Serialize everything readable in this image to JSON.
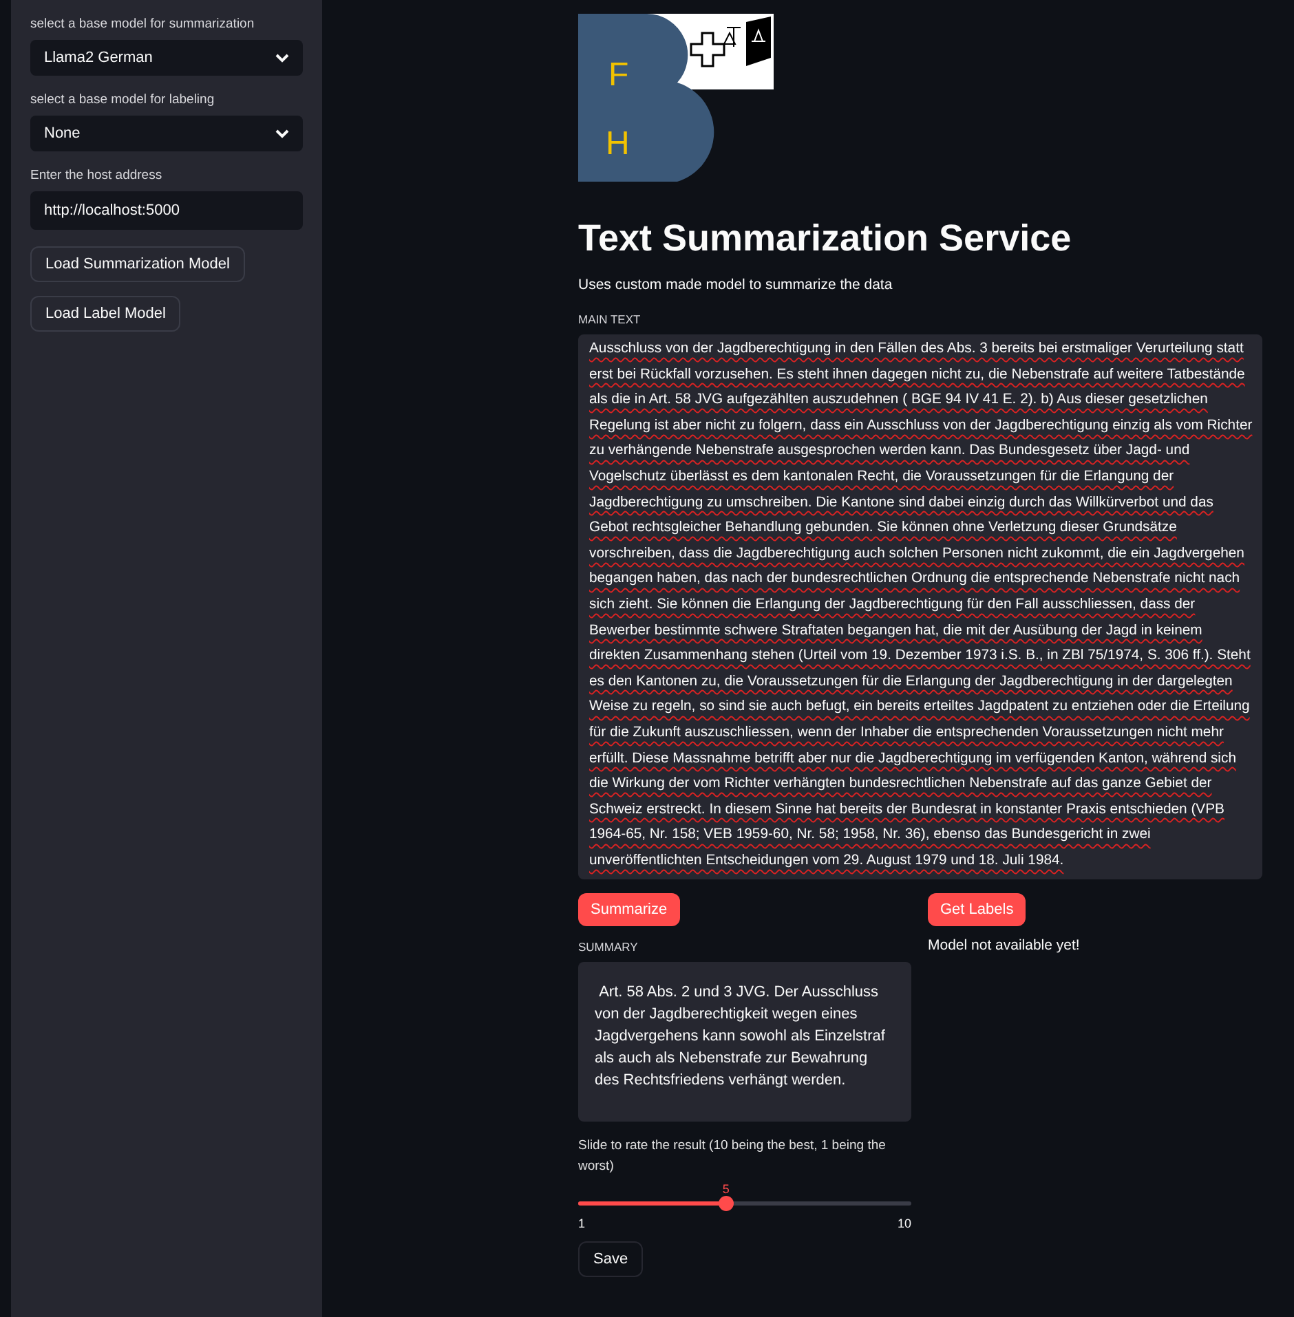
{
  "sidebar": {
    "fields": [
      {
        "kind": "select",
        "label": "select a base model for summarization",
        "value": "Llama2 German"
      },
      {
        "kind": "select",
        "label": "select a base model for labeling",
        "value": "None"
      },
      {
        "kind": "input",
        "label": "Enter the host address",
        "value": "http://localhost:5000"
      }
    ],
    "buttons": [
      "Load Summarization Model",
      "Load Label Model"
    ]
  },
  "logo": {
    "letters": [
      "F",
      "H"
    ]
  },
  "title": "Text Summarization Service",
  "subtitle": "Uses custom made model to summarize the data",
  "main_text": {
    "label": "MAIN TEXT",
    "value": "Ausschluss von der Jagdberechtigung in den Fällen des Abs. 3 bereits bei erstmaliger Verurteilung statt erst bei Rückfall vorzusehen. Es steht ihnen dagegen nicht zu, die Nebenstrafe auf weitere Tatbestände als die in Art. 58 JVG aufgezählten auszudehnen ( BGE 94 IV 41 E. 2). b) Aus dieser gesetzlichen Regelung ist aber nicht zu folgern, dass ein Ausschluss von der Jagdberechtigung einzig als vom Richter zu verhängende Nebenstrafe ausgesprochen werden kann. Das Bundesgesetz über Jagd- und Vogelschutz überlässt es dem kantonalen Recht, die Voraussetzungen für die Erlangung der Jagdberechtigung zu umschreiben. Die Kantone sind dabei einzig durch das Willkürverbot und das Gebot rechtsgleicher Behandlung gebunden. Sie können ohne Verletzung dieser Grundsätze vorschreiben, dass die Jagdberechtigung auch solchen Personen nicht zukommt, die ein Jagdvergehen begangen haben, das nach der bundesrechtlichen Ordnung die entsprechende Nebenstrafe nicht nach sich zieht. Sie können die Erlangung der Jagdberechtigung für den Fall ausschliessen, dass der Bewerber bestimmte schwere Straftaten begangen hat, die mit der Ausübung der Jagd in keinem direkten Zusammenhang stehen (Urteil vom 19. Dezember 1973 i.S. B., in ZBl 75/1974, S. 306 ff.). Steht es den Kantonen zu, die Voraussetzungen für die Erlangung der Jagdberechtigung in der dargelegten Weise zu regeln, so sind sie auch befugt, ein bereits erteiltes Jagdpatent zu entziehen oder die Erteilung für die Zukunft auszuschliessen, wenn der Inhaber die entsprechenden Voraussetzungen nicht mehr erfüllt. Diese Massnahme betrifft aber nur die Jagdberechtigung im verfügenden Kanton, während sich die Wirkung der vom Richter verhängten bundesrechtlichen Nebenstrafe auf das ganze Gebiet der Schweiz erstreckt. In diesem Sinne hat bereits der Bundesrat in konstanter Praxis entschieden (VPB 1964-65, Nr. 158; VEB 1959-60, Nr. 58; 1958, Nr. 36), ebenso das Bundesgericht in zwei unveröffentlichten Entscheidungen vom 29. August 1979 und 18. Juli 1984."
  },
  "summarize_button": "Summarize",
  "labels_button": "Get Labels",
  "summary": {
    "label": "SUMMARY",
    "value": " Art. 58 Abs. 2 und 3 JVG. Der Ausschluss von der Jagdberechtigkeit wegen eines Jagdvergehens kann sowohl als Einzelstraf als auch als Nebenstrafe zur Bewahrung des Rechtsfriedens verhängt werden."
  },
  "labels_message": "Model not available yet!",
  "rating": {
    "label": "Slide to rate the result (10 being the best, 1 being the worst)",
    "value": "5",
    "level": 0.444,
    "min": "1",
    "max": "10"
  },
  "save_button": "Save"
}
